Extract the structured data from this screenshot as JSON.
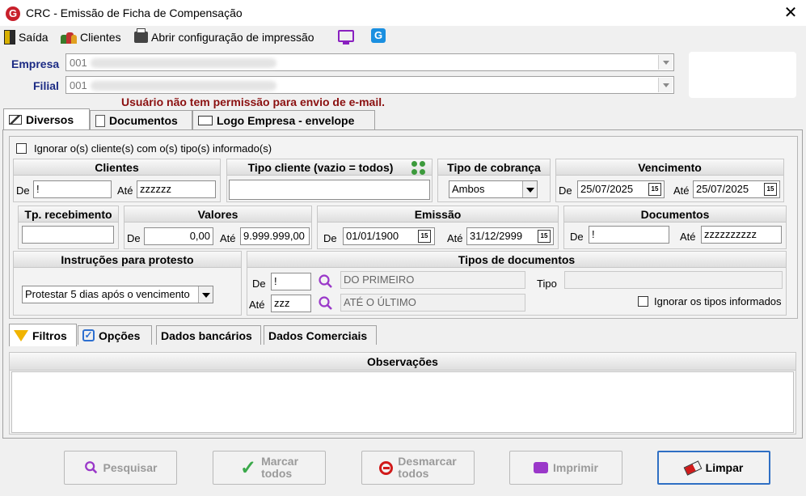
{
  "window": {
    "title": "CRC - Emissão de Ficha de Compensação"
  },
  "menu": {
    "exit": "Saída",
    "clients": "Clientes",
    "print_config": "Abrir configuração de impressão"
  },
  "company": {
    "empresa_label": "Empresa",
    "empresa_value": "001",
    "filial_label": "Filial",
    "filial_value": "001"
  },
  "warning": "Usuário não tem permissão para envio de e-mail.",
  "tabs": [
    "Diversos",
    "Documentos",
    "Logo Empresa - envelope"
  ],
  "filters": {
    "ignore_clients_label": "Ignorar o(s) cliente(s) com o(s) tipo(s) informado(s)",
    "clientes": {
      "title": "Clientes",
      "de_label": "De",
      "de_value": "!",
      "ate_label": "Até",
      "ate_value": "zzzzzz"
    },
    "tipo_cliente": {
      "title": "Tipo cliente (vazio = todos)",
      "value": ""
    },
    "tipo_cobranca": {
      "title": "Tipo de cobrança",
      "value": "Ambos"
    },
    "vencimento": {
      "title": "Vencimento",
      "de_label": "De",
      "de_value": "25/07/2025",
      "ate_label": "Até",
      "ate_value": "25/07/2025"
    },
    "tp_recebimento": {
      "title": "Tp. recebimento",
      "value": ""
    },
    "valores": {
      "title": "Valores",
      "de_label": "De",
      "de_value": "0,00",
      "ate_label": "Até",
      "ate_value": "9.999.999,00"
    },
    "emissao": {
      "title": "Emissão",
      "de_label": "De",
      "de_value": "01/01/1900",
      "ate_label": "Até",
      "ate_value": "31/12/2999"
    },
    "documentos": {
      "title": "Documentos",
      "de_label": "De",
      "de_value": "!",
      "ate_label": "Até",
      "ate_value": "zzzzzzzzzz"
    },
    "instrucoes": {
      "title": "Instruções para protesto",
      "value": "Protestar 5 dias após o vencimento"
    },
    "tipos_documentos": {
      "title": "Tipos de documentos",
      "de_label": "De",
      "de_value": "!",
      "de_desc": "DO PRIMEIRO",
      "ate_label": "Até",
      "ate_value": "zzz",
      "ate_desc": "ATÉ O ÚLTIMO",
      "tipo_label": "Tipo",
      "tipo_value": "",
      "ignore_label": "Ignorar os tipos informados"
    }
  },
  "cal_icon": "15",
  "sub_tabs": [
    "Filtros",
    "Opções",
    "Dados bancários",
    "Dados Comerciais"
  ],
  "observacoes": {
    "title": "Observações",
    "value": ""
  },
  "buttons": {
    "pesquisar": "Pesquisar",
    "marcar_1": "Marcar",
    "marcar_2": "todos",
    "desmarcar_1": "Desmarcar",
    "desmarcar_2": "todos",
    "imprimir": "Imprimir",
    "limpar": "Limpar"
  },
  "colors": {
    "label_blue": "#1c2b84",
    "warning_red": "#8b1010",
    "accent": "#2f6fc4"
  }
}
